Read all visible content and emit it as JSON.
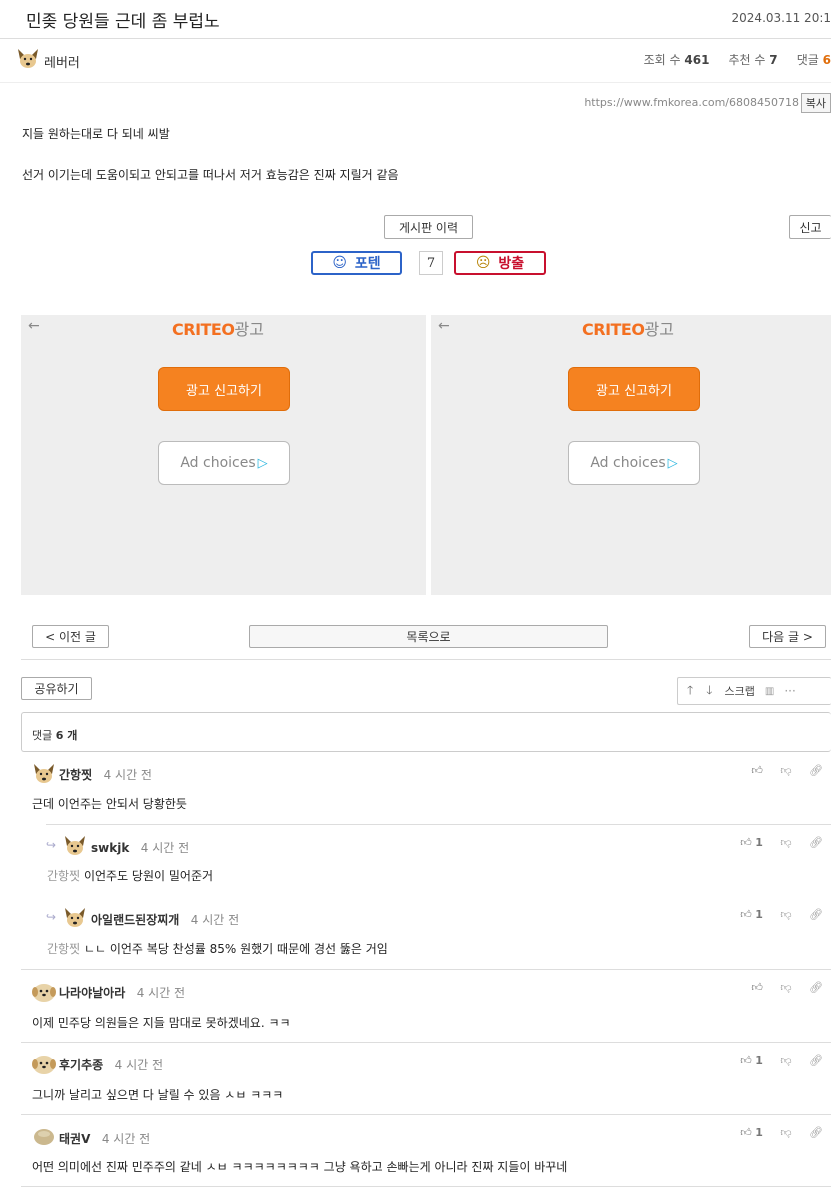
{
  "post": {
    "title": "민좆 당원들 근데 좀 부럽노",
    "date": "2024.03.11 20:1",
    "author": "레버러",
    "views_label": "조회 수",
    "views": "461",
    "recommend_label": "추천 수",
    "recommend": "7",
    "comments_label": "댓글",
    "comments": "6",
    "url": "https://www.fmkorea.com/6808450718",
    "copy_label": "복사",
    "lines": [
      "지들 원하는대로 다 되네 씨발",
      "선거 이기는데 도움이되고 안되고를 떠나서 저거 효능감은 진짜 지릴거 같음"
    ]
  },
  "actions": {
    "history_label": "게시판 이력",
    "report_label": "신고",
    "upvote_label": "포텐",
    "vote_count": "7",
    "downvote_label": "방출"
  },
  "ads": [
    {
      "brand": "CRITEO",
      "brand_suffix": "광고",
      "report_label": "광고 신고하기",
      "choices_label": "Ad choices"
    },
    {
      "brand": "CRITEO",
      "brand_suffix": "광고",
      "report_label": "광고 신고하기",
      "choices_label": "Ad choices"
    }
  ],
  "nav": {
    "prev_label": "< 이전 글",
    "list_label": "목록으로",
    "next_label": "다음 글 >",
    "share_label": "공유하기",
    "scrap_label": "스크랩"
  },
  "comments_header": {
    "label": "댓글",
    "count": "6 개"
  },
  "comments": [
    {
      "name": "간항찟",
      "time": "4 시간 전",
      "text": "근데 이언주는 안되서 당황한듯",
      "likes": "",
      "reply_to": "",
      "is_reply": false
    },
    {
      "name": "swkjk",
      "time": "4 시간 전",
      "text": "이언주도 당원이 밀어준거",
      "likes": "1",
      "reply_to": "간항찟",
      "is_reply": true
    },
    {
      "name": "아일랜드된장찌개",
      "time": "4 시간 전",
      "text": "ㄴㄴ 이언주 복당 찬성률 85% 원했기 때문에 경선 뚫은 거임",
      "likes": "1",
      "reply_to": "간항찟",
      "is_reply": true
    },
    {
      "name": "나라야날아라",
      "time": "4 시간 전",
      "text": "이제 민주당 의원들은 지들 맘대로 못하겠네요. ㅋㅋ",
      "likes": "",
      "reply_to": "",
      "is_reply": false
    },
    {
      "name": "후기추종",
      "time": "4 시간 전",
      "text": "그니까 날리고 싶으면 다 날릴 수 있음 ㅅㅂ ㅋㅋㅋ",
      "likes": "1",
      "reply_to": "",
      "is_reply": false
    },
    {
      "name": "태권V",
      "time": "4 시간 전",
      "text": "어떤 의미에선 진짜 민주주의 같네 ㅅㅂ ㅋㅋㅋㅋㅋㅋㅋㅋ 그냥 욕하고 손빠는게 아니라 진짜 지들이 바꾸네",
      "likes": "1",
      "reply_to": "",
      "is_reply": false
    }
  ],
  "icons": {
    "like": "thumbs-up-icon",
    "dislike": "thumbs-down-icon",
    "link": "link-icon"
  },
  "colors": {
    "upvote_border": "#2c63c8",
    "downvote_border": "#c8102e",
    "ad_button": "#f58220"
  }
}
